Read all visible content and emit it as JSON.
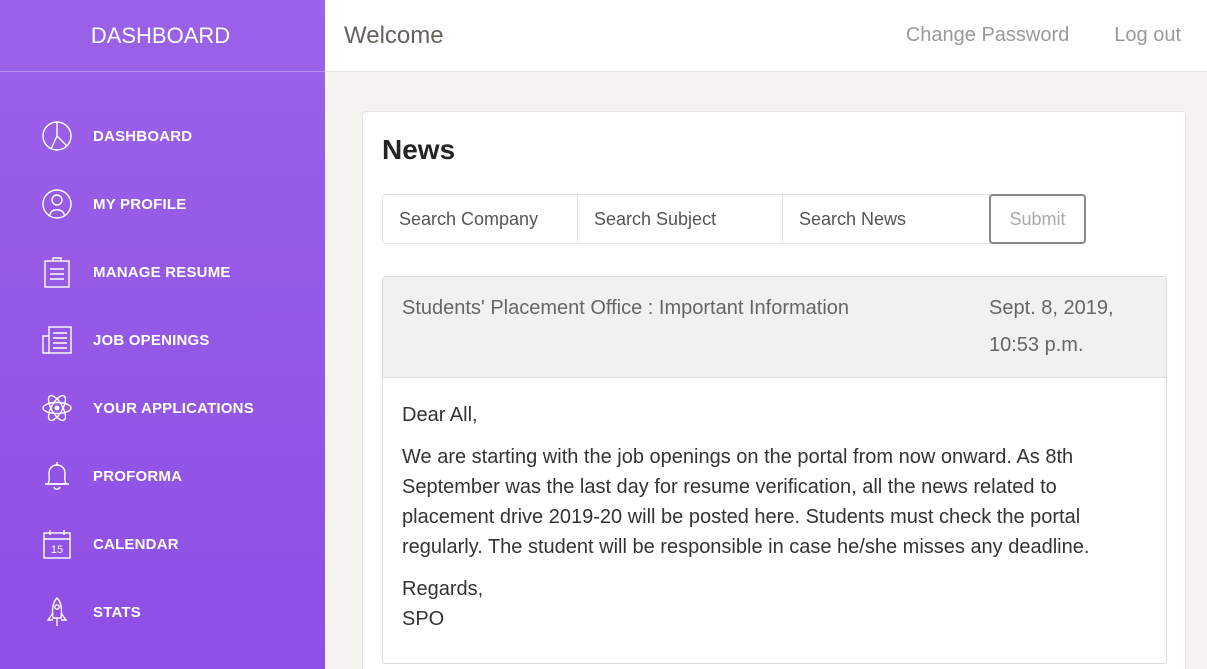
{
  "sidebar": {
    "brand": "DASHBOARD",
    "items": [
      {
        "label": "DASHBOARD",
        "icon": "pie-chart-icon"
      },
      {
        "label": "MY PROFILE",
        "icon": "user-icon"
      },
      {
        "label": "MANAGE RESUME",
        "icon": "clipboard-icon"
      },
      {
        "label": "JOB OPENINGS",
        "icon": "newspaper-icon"
      },
      {
        "label": "YOUR APPLICATIONS",
        "icon": "atom-icon"
      },
      {
        "label": "PROFORMA",
        "icon": "bell-icon"
      },
      {
        "label": "CALENDAR",
        "icon": "calendar-icon",
        "icon_text": "15"
      },
      {
        "label": "STATS",
        "icon": "rocket-icon"
      }
    ]
  },
  "header": {
    "welcome": "Welcome",
    "change_password": "Change Password",
    "logout": "Log out"
  },
  "card": {
    "title": "News",
    "search": {
      "company_placeholder": "Search Company",
      "subject_placeholder": "Search Subject",
      "news_placeholder": "Search News",
      "submit_label": "Submit"
    },
    "news_item": {
      "subject": "Students' Placement Office : Important Information",
      "date_line1": "Sept. 8, 2019,",
      "date_line2": "10:53 p.m.",
      "greeting": "Dear All,",
      "body": "We are starting with the job openings on the portal from now onward. As 8th September was the last day for resume verification, all the news related to placement drive 2019-20 will be posted here. Students must check the portal regularly. The student will be responsible in case he/she misses any deadline.",
      "signoff": "Regards,",
      "signature": "SPO"
    }
  },
  "colors": {
    "sidebar_top": "#9a62e8",
    "sidebar_bottom": "#8f4ee6"
  }
}
